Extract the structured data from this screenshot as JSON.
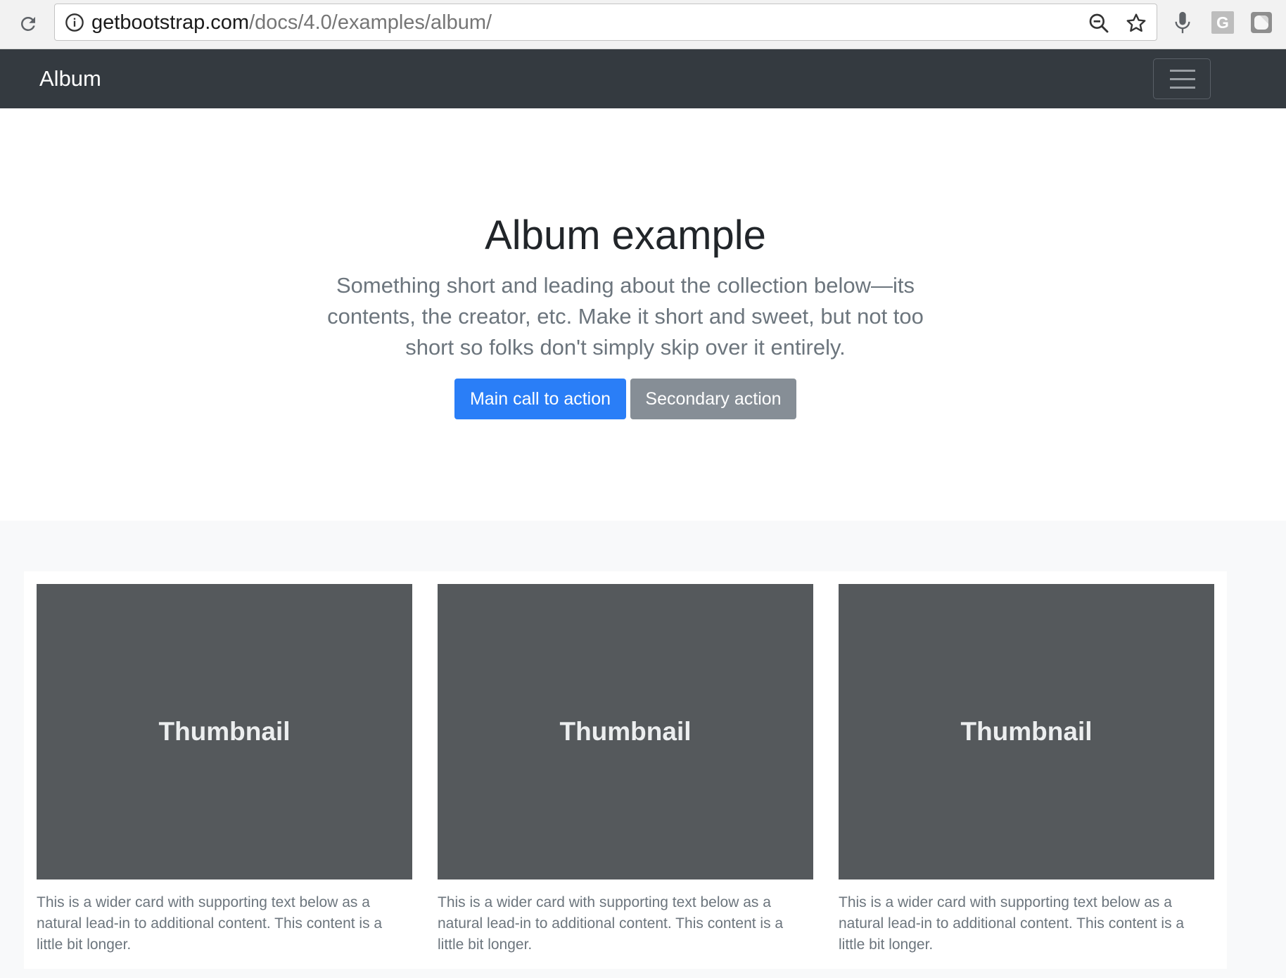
{
  "browser": {
    "url_host": "getbootstrap.com",
    "url_path": "/docs/4.0/examples/album/",
    "extension_g_label": "G",
    "icons": [
      "reload-icon",
      "info-icon",
      "zoom-out-icon",
      "star-icon",
      "microphone-icon",
      "extension-g-icon",
      "extension-icon"
    ]
  },
  "navbar": {
    "brand": "Album",
    "background": "#343a40",
    "toggler_icon": "hamburger-menu-icon"
  },
  "jumbotron": {
    "title": "Album example",
    "lead": "Something short and leading about the collection below—its contents, the creator, etc. Make it short and sweet, but not too short so folks don't simply skip over it entirely.",
    "primary_button": "Main call to action",
    "secondary_button": "Secondary action",
    "primary_color": "#2a7ef7",
    "secondary_color": "#868e96"
  },
  "album": {
    "background": "#f8f9fa",
    "cards": [
      {
        "thumbnail_label": "Thumbnail",
        "text": "This is a wider card with supporting text below as a natural lead-in to additional content. This content is a little bit longer."
      },
      {
        "thumbnail_label": "Thumbnail",
        "text": "This is a wider card with supporting text below as a natural lead-in to additional content. This content is a little bit longer."
      },
      {
        "thumbnail_label": "Thumbnail",
        "text": "This is a wider card with supporting text below as a natural lead-in to additional content. This content is a little bit longer."
      }
    ]
  }
}
